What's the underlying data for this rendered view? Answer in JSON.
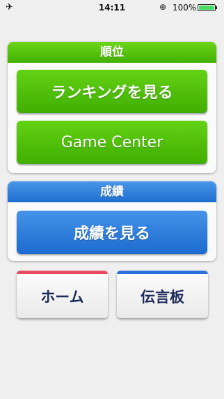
{
  "status_bar": {
    "time": "14:11",
    "battery_percent": "100%",
    "airplane_icon": "airplane-icon",
    "lock_icon": "orientation-lock-icon",
    "battery_icon": "battery-icon",
    "battery_color": "#4cd964"
  },
  "ranking_section": {
    "title": "順位",
    "ranking_button": "ランキングを見る",
    "game_center_button": "Game Center",
    "accent_color": "#4fc30b"
  },
  "results_section": {
    "title": "成績",
    "results_button": "成績を見る",
    "accent_color": "#2a7ddd"
  },
  "bottom_buttons": {
    "home": {
      "label": "ホーム",
      "color": "#e84a5f"
    },
    "board": {
      "label": "伝言板",
      "color": "#2a6fdc"
    }
  }
}
